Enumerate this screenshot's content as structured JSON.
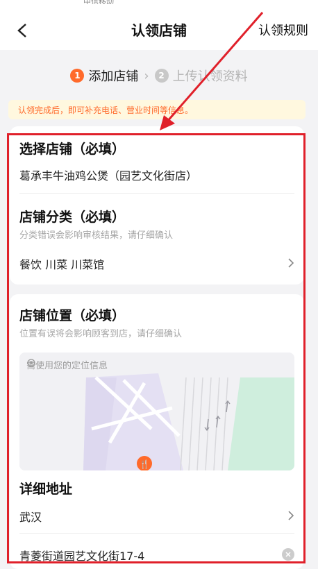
{
  "header": {
    "status_fragment": "中信移动",
    "title": "认领店铺",
    "rules_link": "认领规则"
  },
  "steps": [
    {
      "num": "1",
      "label": "添加店铺"
    },
    {
      "num": "2",
      "label": "上传认领资料"
    }
  ],
  "notice": "认领完成后，即可补充电话、营业时间等信息。",
  "store": {
    "title": "选择店铺（必填）",
    "value": "葛承丰牛油鸡公煲（园艺文化街店）"
  },
  "category": {
    "title": "店铺分类（必填）",
    "hint": "分类错误会影响审核结果，请仔细确认",
    "value": "餐饮  川菜  川菜馆"
  },
  "location": {
    "title": "店铺位置（必填）",
    "hint": "位置有误将会影响顾客到店，请仔细确认",
    "map_hint": "需使用您的定位信息"
  },
  "address": {
    "title": "详细地址",
    "city": "武汉",
    "street": "青菱街道园艺文化街17-4"
  },
  "colors": {
    "accent": "#ff6a2b",
    "annotation_red": "#e0202a",
    "map_park": "#cfeedd",
    "map_block": "#e4e0f3"
  },
  "icons": [
    "back-arrow-icon",
    "chevron-right-icon",
    "location-target-icon",
    "restaurant-pin-icon",
    "clear-icon"
  ]
}
